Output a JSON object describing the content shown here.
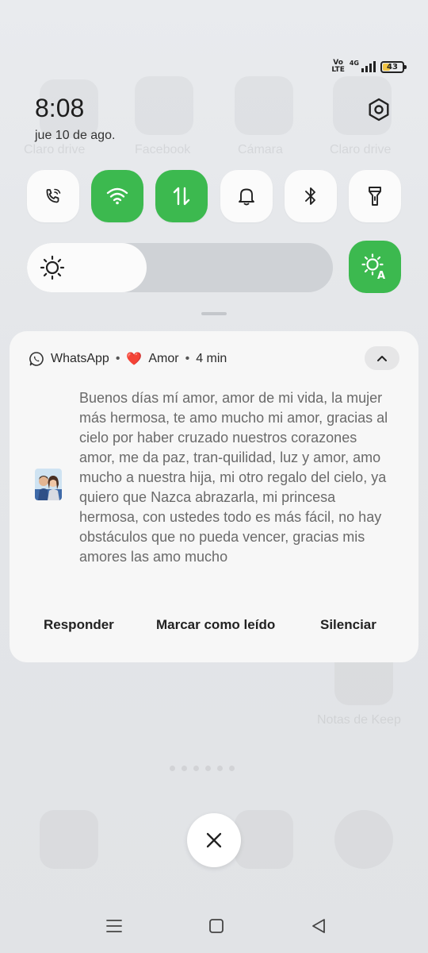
{
  "status_bar": {
    "volte_top": "Vo",
    "volte_bottom": "LTE",
    "network": "4G",
    "battery_level": "43",
    "battery_fraction": 0.43
  },
  "header": {
    "time": "8:08",
    "date": "jue 10 de ago.",
    "settings_icon": "gear-icon"
  },
  "quick_settings": {
    "tiles": [
      {
        "name": "wifi-calling",
        "icon": "phone-wifi-icon",
        "active": false
      },
      {
        "name": "wifi",
        "icon": "wifi-icon",
        "active": true
      },
      {
        "name": "mobile-data",
        "icon": "data-arrows-icon",
        "active": true
      },
      {
        "name": "sound",
        "icon": "bell-icon",
        "active": false
      },
      {
        "name": "bluetooth",
        "icon": "bluetooth-icon",
        "active": false
      },
      {
        "name": "flashlight",
        "icon": "flashlight-icon",
        "active": false
      }
    ],
    "brightness_level": 0.39,
    "auto_brightness_active": true,
    "active_color": "#3cb94f"
  },
  "notification": {
    "app": "WhatsApp",
    "bullet": "•",
    "heart": "❤️",
    "contact": "Amor",
    "time_ago": "4 min",
    "message": "Buenos días mí amor, amor de mi vida, la mujer más hermosa,  te amo mucho mi amor, gracias al cielo por haber cruzado nuestros corazones amor, me da paz, tran-quilidad, luz y amor, amo mucho a nuestra hija, mi otro regalo del cielo, ya quiero que Nazca abrazarla, mi princesa hermosa, con ustedes todo es más fácil, no hay obstáculos que no pueda vencer, gracias mis amores las amo mucho",
    "actions": {
      "reply": "Responder",
      "mark_read": "Marcar como leído",
      "mute": "Silenciar"
    }
  },
  "controls": {
    "close_icon": "close-icon"
  },
  "background_home": {
    "labels": [
      "Claro drive",
      "Facebook",
      "Cámara",
      "Claro drive",
      "Notas de Keep"
    ]
  }
}
